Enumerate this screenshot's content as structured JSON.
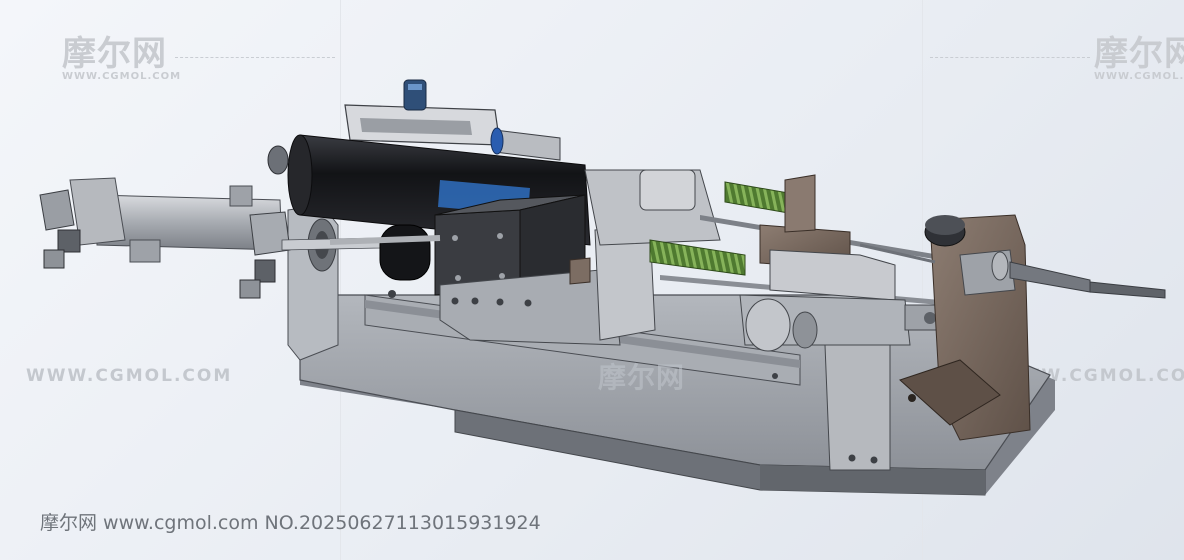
{
  "watermark": {
    "brand_cn": "摩尔网",
    "brand_url_small": "WWW.CGMOL.COM",
    "brand_url_large": "WWW.CGMOL.COM",
    "center_cn": "摩尔网"
  },
  "footer": {
    "caption": "摩尔网 www.cgmol.com NO.20250627113015931924"
  },
  "colors": {
    "background": "#eef1f5",
    "base_plate": "#9a9ea5",
    "motor_body": "#1c1d20",
    "bracket_brown": "#7a6a60",
    "spring_green": "#5f8c3a",
    "accent_blue": "#2a5db0"
  }
}
